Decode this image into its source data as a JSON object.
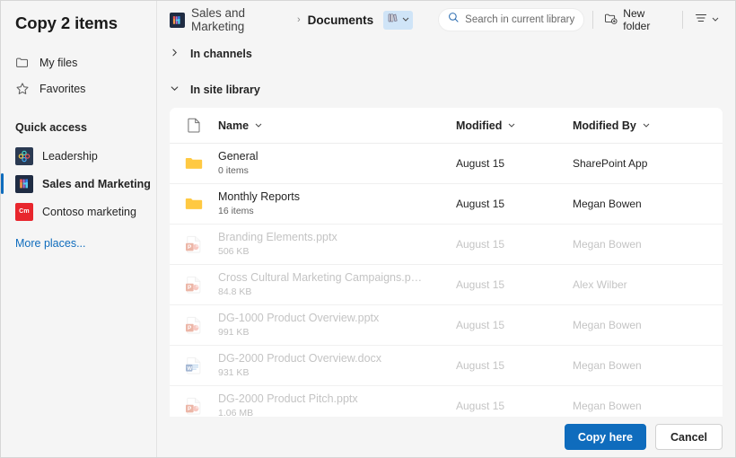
{
  "dialog": {
    "title": "Copy 2 items"
  },
  "sidebar": {
    "nav": [
      {
        "label": "My files",
        "icon": "folder-icon"
      },
      {
        "label": "Favorites",
        "icon": "star-icon"
      }
    ],
    "quick_access_label": "Quick access",
    "sites": [
      {
        "label": "Leadership",
        "icon": "leadership-site-icon",
        "selected": false
      },
      {
        "label": "Sales and Marketing",
        "icon": "sales-marketing-site-icon",
        "selected": true
      },
      {
        "label": "Contoso marketing",
        "icon": "contoso-marketing-site-icon",
        "badge": "Cm",
        "selected": false
      }
    ],
    "more_places": "More places..."
  },
  "topbar": {
    "breadcrumb": {
      "site": "Sales and Marketing",
      "separator": "›",
      "current": "Documents"
    },
    "library_chip_icon": "library-books-icon",
    "search": {
      "placeholder": "Search in current library",
      "value": "",
      "icon": "search-icon"
    },
    "new_folder": {
      "label": "New folder",
      "icon": "new-folder-icon"
    },
    "view_options": {
      "icon": "view-options-icon"
    }
  },
  "sections": [
    {
      "key": "channels",
      "label": "In channels",
      "expanded": false
    },
    {
      "key": "site_library",
      "label": "In site library",
      "expanded": true
    }
  ],
  "table": {
    "columns": {
      "icon": "file-type-icon",
      "name": "Name",
      "modified": "Modified",
      "modified_by": "Modified By"
    },
    "rows": [
      {
        "name": "General",
        "sub": "0 items",
        "modified": "August 15",
        "modified_by": "SharePoint App",
        "type": "folder",
        "disabled": false
      },
      {
        "name": "Monthly Reports",
        "sub": "16 items",
        "modified": "August 15",
        "modified_by": "Megan Bowen",
        "type": "folder",
        "disabled": false
      },
      {
        "name": "Branding Elements.pptx",
        "sub": "506 KB",
        "modified": "August 15",
        "modified_by": "Megan Bowen",
        "type": "pptx",
        "disabled": true
      },
      {
        "name": "Cross Cultural Marketing Campaigns.p…",
        "sub": "84.8 KB",
        "modified": "August 15",
        "modified_by": "Alex Wilber",
        "type": "pptx",
        "disabled": true
      },
      {
        "name": "DG-1000 Product Overview.pptx",
        "sub": "991 KB",
        "modified": "August 15",
        "modified_by": "Megan Bowen",
        "type": "pptx",
        "disabled": true
      },
      {
        "name": "DG-2000 Product Overview.docx",
        "sub": "931 KB",
        "modified": "August 15",
        "modified_by": "Megan Bowen",
        "type": "docx",
        "disabled": true
      },
      {
        "name": "DG-2000 Product Pitch.pptx",
        "sub": "1.06 MB",
        "modified": "August 15",
        "modified_by": "Megan Bowen",
        "type": "pptx",
        "disabled": true
      }
    ]
  },
  "footer": {
    "primary": "Copy here",
    "cancel": "Cancel"
  },
  "colors": {
    "accent": "#0f6cbd",
    "folder": "#ffc942",
    "powerpoint": "#d35230",
    "word": "#2b579a",
    "contoso_red": "#e8262d",
    "chip_bg": "#cfe4f7"
  }
}
